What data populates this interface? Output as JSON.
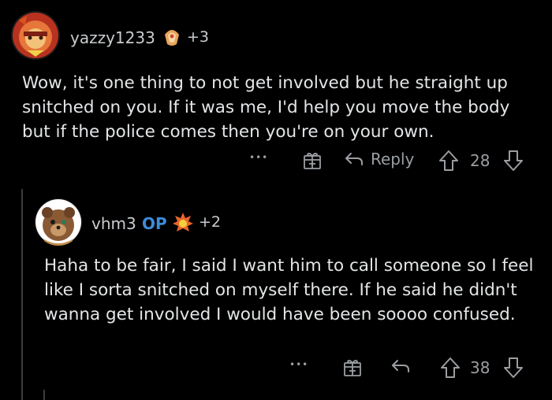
{
  "comments": [
    {
      "username": "yazzy1233",
      "award_count": "+3",
      "body": "Wow, it's one thing to not get involved but he straight up snitched on you. If it was me, I'd help you move the body but if the police comes then you're on your own.",
      "actions": {
        "more": "•••",
        "reply": "Reply",
        "votes": "28"
      }
    },
    {
      "username": "vhm3",
      "op_tag": "OP",
      "award_count": "+2",
      "body": "Haha to be fair, I said I want him to call someone so I feel like I sorta snitched on myself there. If he said he didn't wanna get involved I would have been soooo confused.",
      "actions": {
        "more": "•••",
        "votes": "38"
      }
    }
  ],
  "colors": {
    "background": "#000000",
    "text": "#e3e5e7",
    "muted": "#9a9ea2",
    "op": "#3d8bd9",
    "thread_line": "#3a3c3e"
  }
}
